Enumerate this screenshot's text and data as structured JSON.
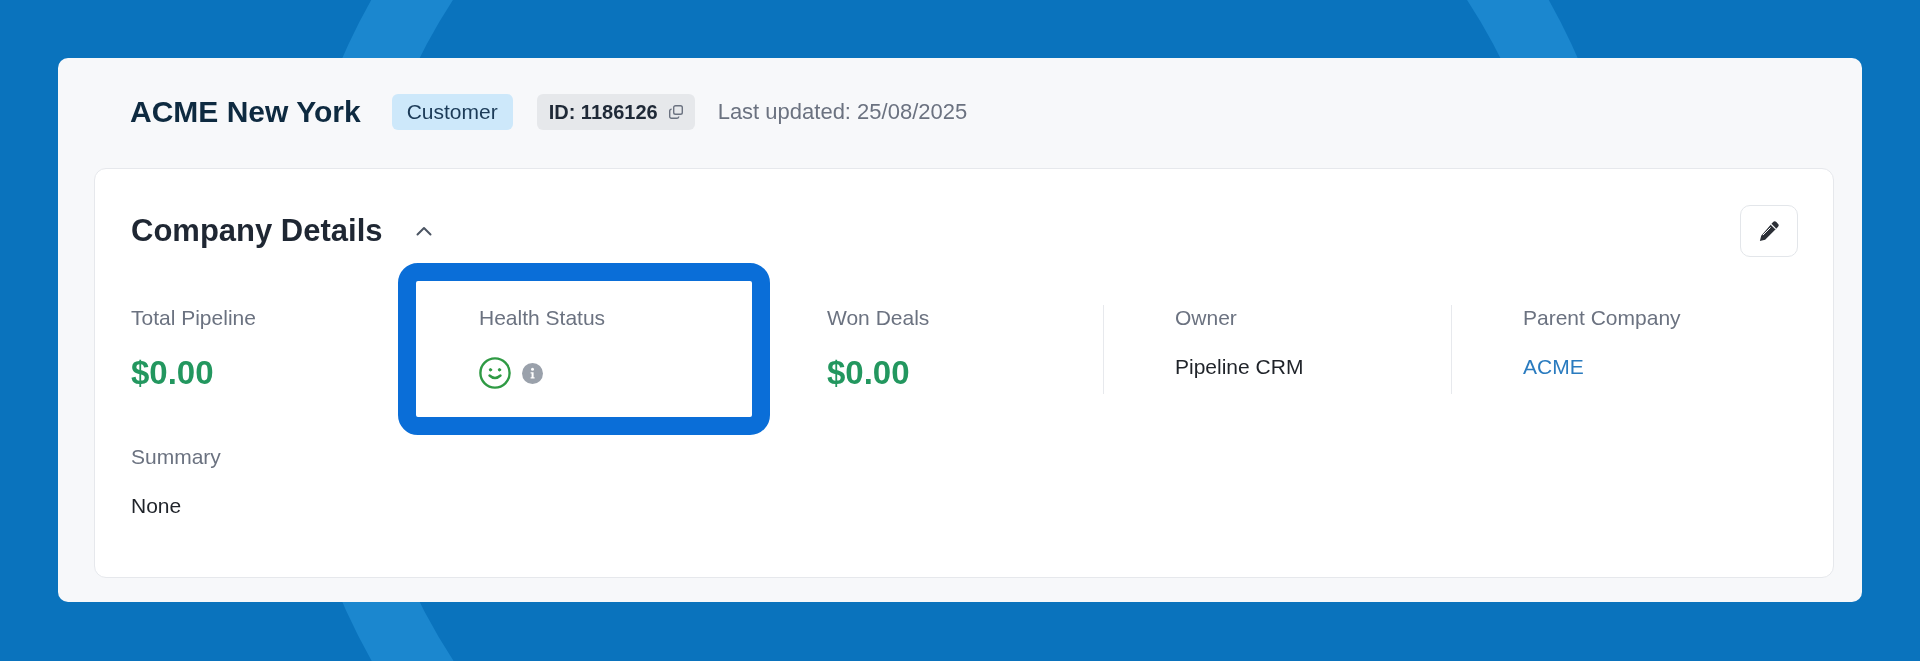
{
  "page": {
    "title": "ACME New York",
    "type_label": "Customer",
    "record_id": "ID: 1186126",
    "last_updated": "Last updated: 25/08/2025"
  },
  "details": {
    "title": "Company Details",
    "expanded": true,
    "fields": [
      {
        "kind": "money",
        "label": "Total Pipeline",
        "value": "$0.00",
        "highlighted": false
      },
      {
        "kind": "health",
        "label": "Health Status",
        "highlighted": true
      },
      {
        "kind": "money",
        "label": "Won Deals",
        "value": "$0.00",
        "highlighted": false
      },
      {
        "kind": "text",
        "label": "Owner",
        "value": "Pipeline CRM",
        "highlighted": false
      },
      {
        "kind": "link",
        "label": "Parent Company",
        "value": "ACME",
        "highlighted": false
      }
    ],
    "summary": {
      "label": "Summary",
      "value": "None"
    }
  }
}
